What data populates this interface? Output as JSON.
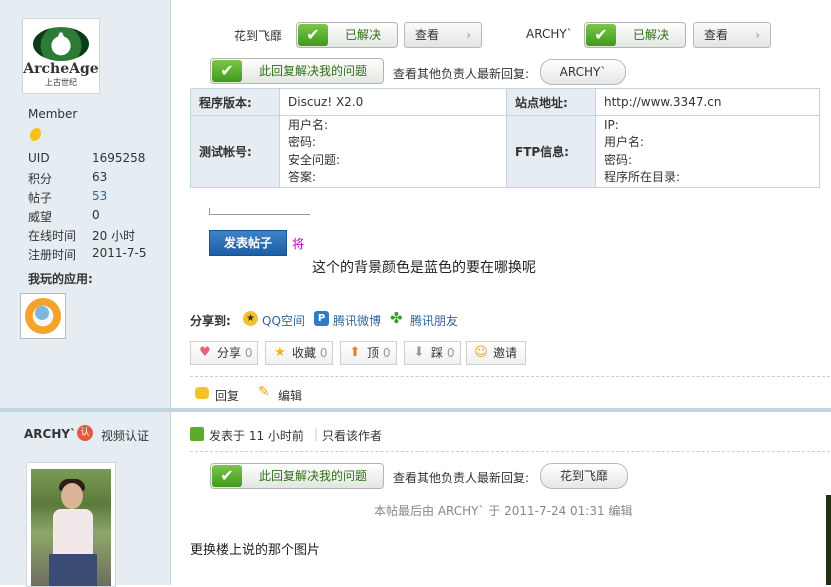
{
  "user1": {
    "avatar_text": "ArcheAge",
    "avatar_subtext": "上古世纪",
    "rank": "Member",
    "rank_icon": "moon-icon",
    "stats": [
      {
        "label": "UID",
        "value": "1695258"
      },
      {
        "label": "积分",
        "value": "63"
      },
      {
        "label": "帖子",
        "value": "53"
      },
      {
        "label": "威望",
        "value": "0"
      },
      {
        "label": "在线时间",
        "value": "20 小时"
      },
      {
        "label": "注册时间",
        "value": "2011-7-5"
      }
    ],
    "apps_title": "我玩的应用:"
  },
  "post1": {
    "solvers": [
      {
        "name": "花到飞靡",
        "status": "已解决",
        "view": "查看"
      },
      {
        "name": "ARCHY`",
        "status": "已解决",
        "view": "查看"
      }
    ],
    "solved_btn": "此回复解决我的问题",
    "other_label": "查看其他负责人最新回复:",
    "other_name": "ARCHY`",
    "table": {
      "version_label": "程序版本:",
      "version_value": "Discuz! X2.0",
      "site_label": "站点地址:",
      "site_value": "http://www.3347.cn",
      "test_label": "测试帐号:",
      "test_fields": [
        "用户名:",
        "密码:",
        "安全问题:",
        "答案:"
      ],
      "ftp_label": "FTP信息:",
      "ftp_fields": [
        "IP:",
        "用户名:",
        "密码:",
        "程序所在目录:"
      ]
    },
    "post_button": "发表帖子",
    "post_side_text": "将",
    "question": "这个的背景颜色是蓝色的要在哪换呢",
    "share_label": "分享到:",
    "share_links": [
      "QQ空间",
      "腾讯微博",
      "腾讯朋友"
    ],
    "actions": [
      {
        "label": "分享",
        "count": "0",
        "icon": "heart-icon"
      },
      {
        "label": "收藏",
        "count": "0",
        "icon": "star-icon"
      },
      {
        "label": "顶",
        "count": "0",
        "icon": "up-arrow-icon"
      },
      {
        "label": "踩",
        "count": "0",
        "icon": "down-arrow-icon"
      },
      {
        "label": "邀请",
        "count": "",
        "icon": "invite-icon"
      }
    ],
    "reply": "回复",
    "edit": "编辑"
  },
  "user2": {
    "name": "ARCHY`",
    "verify_label": "视频认证"
  },
  "post2": {
    "posted_at": "发表于 11 小时前",
    "only_author": "只看该作者",
    "solved_btn": "此回复解决我的问题",
    "other_label": "查看其他负责人最新回复:",
    "other_name": "花到飞靡",
    "edit_note": "本帖最后由 ARCHY` 于 2011-7-24 01:31 编辑",
    "content": "更换楼上说的那个图片"
  }
}
